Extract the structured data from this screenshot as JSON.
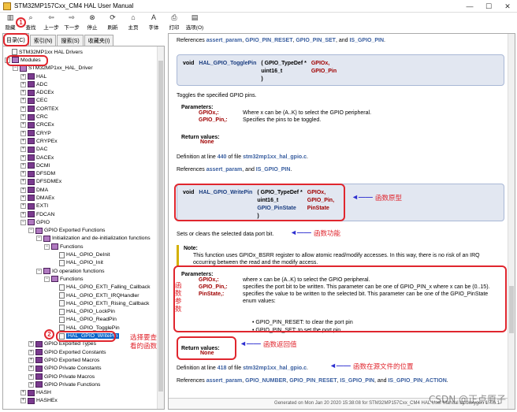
{
  "window": {
    "title": "STM32MP157Cxx_CM4 HAL User Manual"
  },
  "toolbar": [
    {
      "label": "隐藏",
      "icon": "hide-icon",
      "glyph": "▥"
    },
    {
      "label": "查找",
      "icon": "find-icon",
      "glyph": "⌕"
    },
    {
      "label": "上一步",
      "icon": "back-icon",
      "glyph": "⇦"
    },
    {
      "label": "下一步",
      "icon": "forward-icon",
      "glyph": "⇨"
    },
    {
      "label": "停止",
      "icon": "stop-icon",
      "glyph": "⊗"
    },
    {
      "label": "刷新",
      "icon": "refresh-icon",
      "glyph": "⟳"
    },
    {
      "label": "主页",
      "icon": "home-icon",
      "glyph": "⌂"
    },
    {
      "label": "字体",
      "icon": "font-icon",
      "glyph": "A"
    },
    {
      "label": "打印",
      "icon": "print-icon",
      "glyph": "⎙"
    },
    {
      "label": "选项(O)",
      "icon": "options-icon",
      "glyph": "▤"
    }
  ],
  "tabs": [
    "目录(C)",
    "索引(N)",
    "搜索(S)",
    "收藏夹(I)"
  ],
  "tree": [
    {
      "text": "STM32MP1xx HAL Drivers",
      "level": 0,
      "type": "page",
      "exp": ""
    },
    {
      "text": "Modules",
      "level": 0,
      "type": "book-open",
      "exp": "−"
    },
    {
      "text": "STM32MP1xx_HAL_Driver",
      "level": 1,
      "type": "book-open",
      "exp": "−"
    },
    {
      "text": "HAL",
      "level": 2,
      "type": "book",
      "exp": "+"
    },
    {
      "text": "ADC",
      "level": 2,
      "type": "book",
      "exp": "+"
    },
    {
      "text": "ADCEx",
      "level": 2,
      "type": "book",
      "exp": "+"
    },
    {
      "text": "CEC",
      "level": 2,
      "type": "book",
      "exp": "+"
    },
    {
      "text": "CORTEX",
      "level": 2,
      "type": "book",
      "exp": "+"
    },
    {
      "text": "CRC",
      "level": 2,
      "type": "book",
      "exp": "+"
    },
    {
      "text": "CRCEx",
      "level": 2,
      "type": "book",
      "exp": "+"
    },
    {
      "text": "CRYP",
      "level": 2,
      "type": "book",
      "exp": "+"
    },
    {
      "text": "CRYPEx",
      "level": 2,
      "type": "book",
      "exp": "+"
    },
    {
      "text": "DAC",
      "level": 2,
      "type": "book",
      "exp": "+"
    },
    {
      "text": "DACEx",
      "level": 2,
      "type": "book",
      "exp": "+"
    },
    {
      "text": "DCMI",
      "level": 2,
      "type": "book",
      "exp": "+"
    },
    {
      "text": "DFSDM",
      "level": 2,
      "type": "book",
      "exp": "+"
    },
    {
      "text": "DFSDMEx",
      "level": 2,
      "type": "book",
      "exp": "+"
    },
    {
      "text": "DMA",
      "level": 2,
      "type": "book",
      "exp": "+"
    },
    {
      "text": "DMAEx",
      "level": 2,
      "type": "book",
      "exp": "+"
    },
    {
      "text": "EXTI",
      "level": 2,
      "type": "book",
      "exp": "+"
    },
    {
      "text": "FDCAN",
      "level": 2,
      "type": "book",
      "exp": "+"
    },
    {
      "text": "GPIO",
      "level": 2,
      "type": "book-open",
      "exp": "−"
    },
    {
      "text": "GPIO Exported Functions",
      "level": 3,
      "type": "book-open",
      "exp": "−"
    },
    {
      "text": "Initialization and de-initialization functions",
      "level": 4,
      "type": "book-open",
      "exp": "−"
    },
    {
      "text": "Functions",
      "level": 5,
      "type": "book-open",
      "exp": "−"
    },
    {
      "text": "HAL_GPIO_DeInit",
      "level": 6,
      "type": "page",
      "exp": ""
    },
    {
      "text": "HAL_GPIO_Init",
      "level": 6,
      "type": "page",
      "exp": ""
    },
    {
      "text": "IO operation functions",
      "level": 4,
      "type": "book-open",
      "exp": "−"
    },
    {
      "text": "Functions",
      "level": 5,
      "type": "book-open",
      "exp": "−"
    },
    {
      "text": "HAL_GPIO_EXTI_Falling_Callback",
      "level": 6,
      "type": "page",
      "exp": ""
    },
    {
      "text": "HAL_GPIO_EXTI_IRQHandler",
      "level": 6,
      "type": "page",
      "exp": ""
    },
    {
      "text": "HAL_GPIO_EXTI_Rising_Callback",
      "level": 6,
      "type": "page",
      "exp": ""
    },
    {
      "text": "HAL_GPIO_LockPin",
      "level": 6,
      "type": "page",
      "exp": ""
    },
    {
      "text": "HAL_GPIO_ReadPin",
      "level": 6,
      "type": "page",
      "exp": ""
    },
    {
      "text": "HAL_GPIO_TogglePin",
      "level": 6,
      "type": "page",
      "exp": ""
    },
    {
      "text": "HAL_GPIO_WritePin",
      "level": 6,
      "type": "page",
      "exp": "",
      "selected": true
    },
    {
      "text": "GPIO Exported Types",
      "level": 3,
      "type": "book",
      "exp": "+"
    },
    {
      "text": "GPIO Exported Constants",
      "level": 3,
      "type": "book",
      "exp": "+"
    },
    {
      "text": "GPIO Exported Macros",
      "level": 3,
      "type": "book",
      "exp": "+"
    },
    {
      "text": "GPIO Private Constants",
      "level": 3,
      "type": "book",
      "exp": "+"
    },
    {
      "text": "GPIO Private Macros",
      "level": 3,
      "type": "book",
      "exp": "+"
    },
    {
      "text": "GPIO Private Functions",
      "level": 3,
      "type": "book",
      "exp": "+"
    },
    {
      "text": "HASH",
      "level": 2,
      "type": "book",
      "exp": "+"
    },
    {
      "text": "HASHEx",
      "level": 2,
      "type": "book",
      "exp": "+"
    }
  ],
  "doc": {
    "ref_top": {
      "prefix": "References ",
      "k1": "assert_param",
      "s1": ", ",
      "k2": "GPIO_PIN_RESET",
      "s2": ", ",
      "k3": "GPIO_PIN_SET",
      "s3": ", and ",
      "k4": "IS_GPIO_PIN",
      "end": "."
    },
    "toggle": {
      "ret": "void",
      "name": "HAL_GPIO_TogglePin",
      "p1type": "( GPIO_TypeDef *",
      "p1name": "GPIOx,",
      "p2type": "uint16_t",
      "p2name": "GPIO_Pin",
      "close": ")",
      "brief": "Toggles the specified GPIO pins.",
      "params_title": "Parameters:",
      "params": [
        {
          "name": "GPIOx,:",
          "desc": "Where x can be (A..K) to select the GPIO peripheral."
        },
        {
          "name": "GPIO_Pin,:",
          "desc": "Specifies the pins to be toggled."
        }
      ],
      "ret_title": "Return values:",
      "ret_value": "None",
      "def_prefix": "Definition at line ",
      "def_line": "440",
      "def_mid": " of file ",
      "def_file": "stm32mp1xx_hal_gpio.c",
      "def_end": ".",
      "ref_prefix": "References ",
      "ref1": "assert_param",
      "ref_sep": ", and ",
      "ref2": "IS_GPIO_PIN",
      "ref_end": "."
    },
    "write": {
      "ret": "void",
      "name": "HAL_GPIO_WritePin",
      "p1type": "( GPIO_TypeDef *",
      "p1name": "GPIOx,",
      "p2type": "uint16_t",
      "p2name": "GPIO_Pin,",
      "p3type": "GPIO_PinState",
      "p3name": "PinState",
      "close": ")",
      "brief": "Sets or clears the selected data port bit.",
      "note_title": "Note:",
      "note_text": "This function uses GPIOx_BSRR register to allow atomic read/modify accesses. In this way, there is no risk of an IRQ occurring between the read and the modify access.",
      "params_title": "Parameters:",
      "params": [
        {
          "name": "GPIOx,:",
          "desc": "where x can be (A..K) to select the GPIO peripheral."
        },
        {
          "name": "GPIO_Pin,:",
          "desc": "specifies the port bit to be written. This parameter can be one of GPIO_PIN_x where x can be (0..15)."
        },
        {
          "name": "PinState,:",
          "desc": "specifies the value to be written to the selected bit. This parameter can be one of the GPIO_PinState enum values:"
        }
      ],
      "bullets": [
        "GPIO_PIN_RESET: to clear the port pin",
        "GPIO_PIN_SET: to set the port pin"
      ],
      "ret_title": "Return values:",
      "ret_value": "None",
      "def_prefix": "Definition at line ",
      "def_line": "418",
      "def_mid": " of file ",
      "def_file": "stm32mp1xx_hal_gpio.c",
      "def_end": ".",
      "ref_prefix": "References ",
      "refs": [
        "assert_param",
        "GPIO_NUMBER",
        "GPIO_PIN_RESET",
        "IS_GPIO_PIN",
        "IS_GPIO_PIN_ACTION"
      ],
      "ref_seps": [
        ", ",
        ", ",
        ", ",
        ", and "
      ],
      "ref_end": "."
    },
    "footer": "Generated on Mon Jan 20 2020 15:38:08 for STM32MP157Cxx_CM4 HAL User Manual by  doxygen 1.7.6.1"
  },
  "annotations": {
    "circle1": "1",
    "circle2": "2",
    "select_note": "选择要查\n看的函数",
    "proto": "函数原型",
    "func": "函数功能",
    "params_vertical": "函\n数\n参\n数",
    "ret": "函数返回值",
    "location": "函数在源文件的位置",
    "arrow": "◄——"
  },
  "watermark": "CSDN @正点原子",
  "colors": {
    "annotation_red": "#e0262e",
    "annotation_blue": "#2d2fd0",
    "link_blue": "#3a5fa0",
    "param_red": "#a00000"
  }
}
